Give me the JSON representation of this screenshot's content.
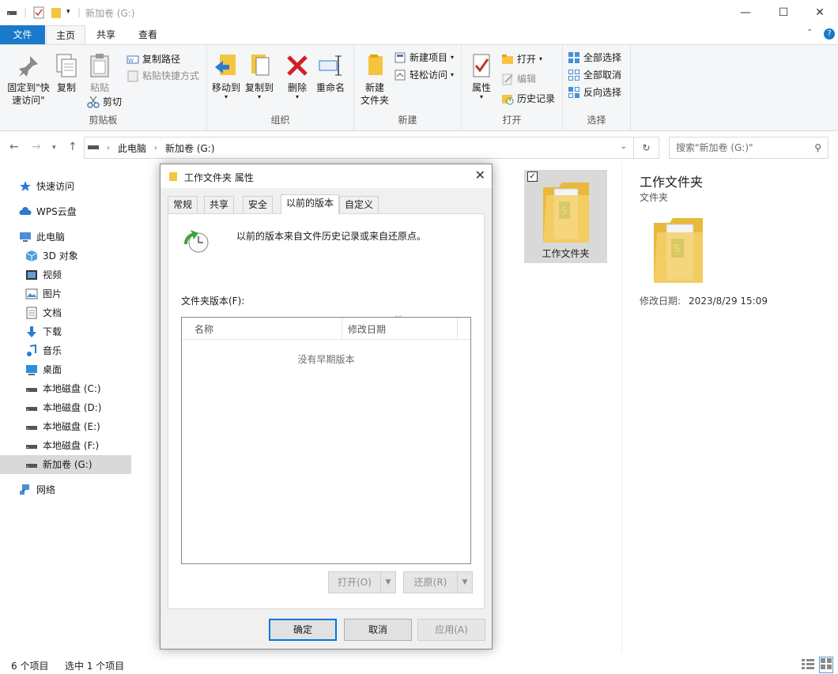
{
  "window": {
    "title": "新加卷 (G:)",
    "controls": {
      "minimize": "—",
      "maximize": "☐",
      "close": "✕"
    }
  },
  "ribbon_tabs": [
    "文件",
    "主页",
    "共享",
    "查看"
  ],
  "ribbon": {
    "clipboard": {
      "pin_label_1": "固定到\"快",
      "pin_label_2": "速访问\"",
      "copy": "复制",
      "paste": "粘贴",
      "copy_path": "复制路径",
      "paste_shortcut": "粘贴快捷方式",
      "cut": "剪切",
      "group": "剪贴板"
    },
    "organize": {
      "move_to": "移动到",
      "copy_to": "复制到",
      "delete": "删除",
      "rename": "重命名",
      "group": "组织"
    },
    "new": {
      "new_folder_1": "新建",
      "new_folder_2": "文件夹",
      "new_item": "新建项目",
      "easy_access": "轻松访问",
      "group": "新建"
    },
    "open": {
      "properties": "属性",
      "open": "打开",
      "edit": "编辑",
      "history": "历史记录",
      "group": "打开"
    },
    "select": {
      "select_all": "全部选择",
      "select_none": "全部取消",
      "invert": "反向选择",
      "group": "选择"
    }
  },
  "address": {
    "crumbs": [
      "此电脑",
      "新加卷 (G:)"
    ],
    "search_placeholder": "搜索\"新加卷 (G:)\""
  },
  "nav": [
    {
      "label": "快速访问",
      "icon": "star-icon"
    },
    {
      "label": "WPS云盘",
      "icon": "cloud-icon"
    },
    {
      "label": "此电脑",
      "icon": "computer-icon"
    },
    {
      "label": "3D 对象",
      "icon": "cube-icon"
    },
    {
      "label": "视频",
      "icon": "video-icon"
    },
    {
      "label": "图片",
      "icon": "picture-icon"
    },
    {
      "label": "文档",
      "icon": "document-icon"
    },
    {
      "label": "下载",
      "icon": "download-icon"
    },
    {
      "label": "音乐",
      "icon": "music-icon"
    },
    {
      "label": "桌面",
      "icon": "desktop-icon"
    },
    {
      "label": "本地磁盘 (C:)",
      "icon": "drive-icon"
    },
    {
      "label": "本地磁盘 (D:)",
      "icon": "drive-icon"
    },
    {
      "label": "本地磁盘 (E:)",
      "icon": "drive-icon"
    },
    {
      "label": "本地磁盘 (F:)",
      "icon": "drive-icon"
    },
    {
      "label": "新加卷 (G:)",
      "icon": "drive-icon"
    },
    {
      "label": "网络",
      "icon": "network-icon"
    }
  ],
  "content": {
    "item_label": "工作文件夹"
  },
  "details": {
    "title": "工作文件夹",
    "type": "文件夹",
    "modified_label": "修改日期:",
    "modified_value": "2023/8/29 15:09"
  },
  "status": {
    "count": "6 个项目",
    "selected": "选中 1 个项目"
  },
  "dialog": {
    "title": "工作文件夹 属性",
    "tabs": [
      "常规",
      "共享",
      "安全",
      "以前的版本",
      "自定义"
    ],
    "message": "以前的版本来自文件历史记录或来自还原点。",
    "versions_label": "文件夹版本(F):",
    "col_name": "名称",
    "col_modified": "修改日期",
    "empty": "没有早期版本",
    "open_btn": "打开(O)",
    "restore_btn": "还原(R)",
    "ok": "确定",
    "cancel": "取消",
    "apply": "应用(A)"
  },
  "colors": {
    "accent": "#1979ca",
    "folder": "#f5c542",
    "selection": "#d9d9d9"
  }
}
